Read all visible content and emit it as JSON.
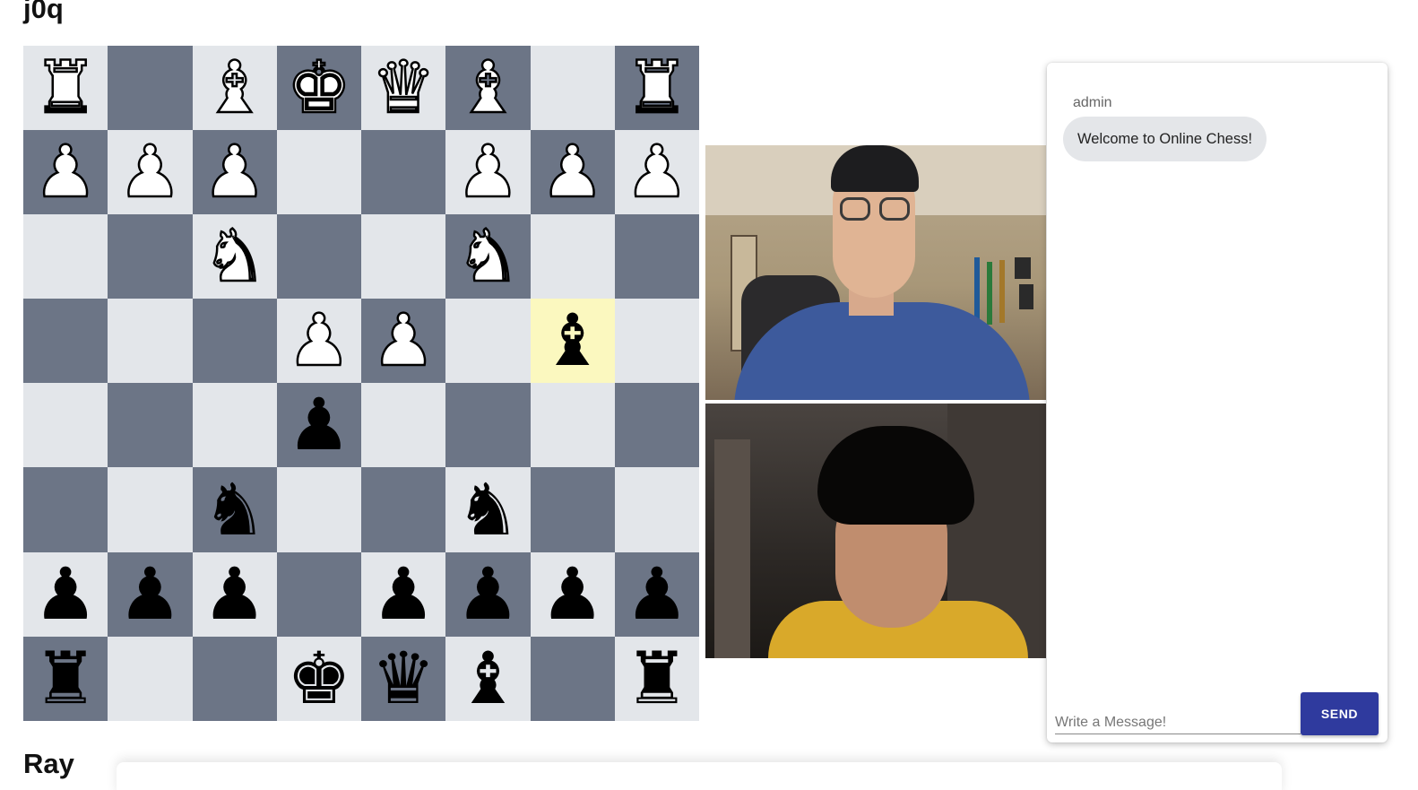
{
  "players": {
    "top": "j0q",
    "bottom": "Ray"
  },
  "board": {
    "highlighted": [
      3,
      6
    ],
    "rows": [
      [
        {
          "p": "♜",
          "c": "white"
        },
        null,
        {
          "p": "♝",
          "c": "white"
        },
        {
          "p": "♚",
          "c": "white"
        },
        {
          "p": "♛",
          "c": "white"
        },
        {
          "p": "♝",
          "c": "white"
        },
        null,
        {
          "p": "♜",
          "c": "white"
        }
      ],
      [
        {
          "p": "♟",
          "c": "white"
        },
        {
          "p": "♟",
          "c": "white"
        },
        {
          "p": "♟",
          "c": "white"
        },
        null,
        null,
        {
          "p": "♟",
          "c": "white"
        },
        {
          "p": "♟",
          "c": "white"
        },
        {
          "p": "♟",
          "c": "white"
        }
      ],
      [
        null,
        null,
        {
          "p": "♞",
          "c": "white"
        },
        null,
        null,
        {
          "p": "♞",
          "c": "white"
        },
        null,
        null
      ],
      [
        null,
        null,
        null,
        {
          "p": "♟",
          "c": "white"
        },
        {
          "p": "♟",
          "c": "white"
        },
        null,
        {
          "p": "♝",
          "c": "black"
        },
        null
      ],
      [
        null,
        null,
        null,
        {
          "p": "♟",
          "c": "black"
        },
        null,
        null,
        null,
        null
      ],
      [
        null,
        null,
        {
          "p": "♞",
          "c": "black"
        },
        null,
        null,
        {
          "p": "♞",
          "c": "black"
        },
        null,
        null
      ],
      [
        {
          "p": "♟",
          "c": "black"
        },
        {
          "p": "♟",
          "c": "black"
        },
        {
          "p": "♟",
          "c": "black"
        },
        null,
        {
          "p": "♟",
          "c": "black"
        },
        {
          "p": "♟",
          "c": "black"
        },
        {
          "p": "♟",
          "c": "black"
        },
        {
          "p": "♟",
          "c": "black"
        }
      ],
      [
        {
          "p": "♜",
          "c": "black"
        },
        null,
        null,
        {
          "p": "♚",
          "c": "black"
        },
        {
          "p": "♛",
          "c": "black"
        },
        {
          "p": "♝",
          "c": "black"
        },
        null,
        {
          "p": "♜",
          "c": "black"
        }
      ]
    ]
  },
  "colors": {
    "light_square": "#e3e6ea",
    "dark_square": "#6c7586",
    "highlight": "#fbf8bf",
    "send_button": "#2f3a9e"
  },
  "chat": {
    "messages": [
      {
        "sender": "admin",
        "text": "Welcome to Online Chess!"
      }
    ],
    "input_placeholder": "Write a Message!",
    "send_label": "SEND"
  }
}
